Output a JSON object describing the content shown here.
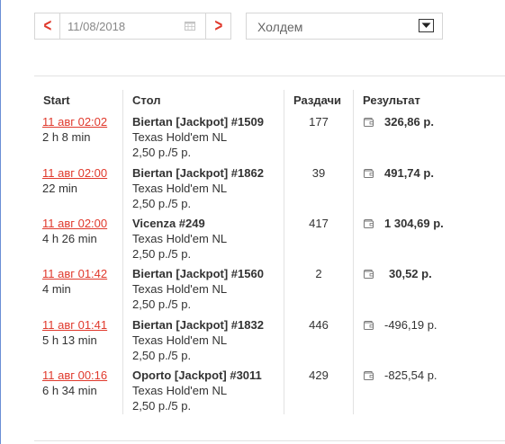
{
  "toolbar": {
    "prev_icon": "chevron-left-icon",
    "date_value": "11/08/2018",
    "next_icon": "chevron-right-icon",
    "game_select": {
      "selected": "Холдем"
    }
  },
  "table": {
    "headers": {
      "start": "Start",
      "table": "Стол",
      "hands": "Раздачи",
      "result": "Результат"
    },
    "rows": [
      {
        "start": "11 авг 02:02",
        "duration": "2 h 8 min",
        "table": "Biertan [Jackpot] #1509",
        "game": "Texas Hold'em NL",
        "stakes": "2,50 р./5 р.",
        "hands": "177",
        "result": "326,86 р.",
        "positive": true
      },
      {
        "start": "11 авг 02:00",
        "duration": "22 min",
        "table": "Biertan [Jackpot] #1862",
        "game": "Texas Hold'em NL",
        "stakes": "2,50 р./5 р.",
        "hands": "39",
        "result": "491,74 р.",
        "positive": true
      },
      {
        "start": "11 авг 02:00",
        "duration": "4 h 26 min",
        "table": "Vicenza #249",
        "game": "Texas Hold'em NL",
        "stakes": "2,50 р./5 р.",
        "hands": "417",
        "result": "1 304,69 р.",
        "positive": true
      },
      {
        "start": "11 авг 01:42",
        "duration": "4 min",
        "table": "Biertan [Jackpot] #1560",
        "game": "Texas Hold'em NL",
        "stakes": "2,50 р./5 р.",
        "hands": "2",
        "result": "30,52 р.",
        "positive": true
      },
      {
        "start": "11 авг 01:41",
        "duration": "5 h 13 min",
        "table": "Biertan [Jackpot] #1832",
        "game": "Texas Hold'em NL",
        "stakes": "2,50 р./5 р.",
        "hands": "446",
        "result": "-496,19 р.",
        "positive": false
      },
      {
        "start": "11 авг 00:16",
        "duration": "6 h 34 min",
        "table": "Oporto [Jackpot] #3011",
        "game": "Texas Hold'em NL",
        "stakes": "2,50 р./5 р.",
        "hands": "429",
        "result": "-825,54 р.",
        "positive": false
      }
    ]
  },
  "colors": {
    "accent": "#e0392c",
    "border": "#d6d6d6",
    "divider": "#e2e2e2",
    "text": "#333333"
  }
}
